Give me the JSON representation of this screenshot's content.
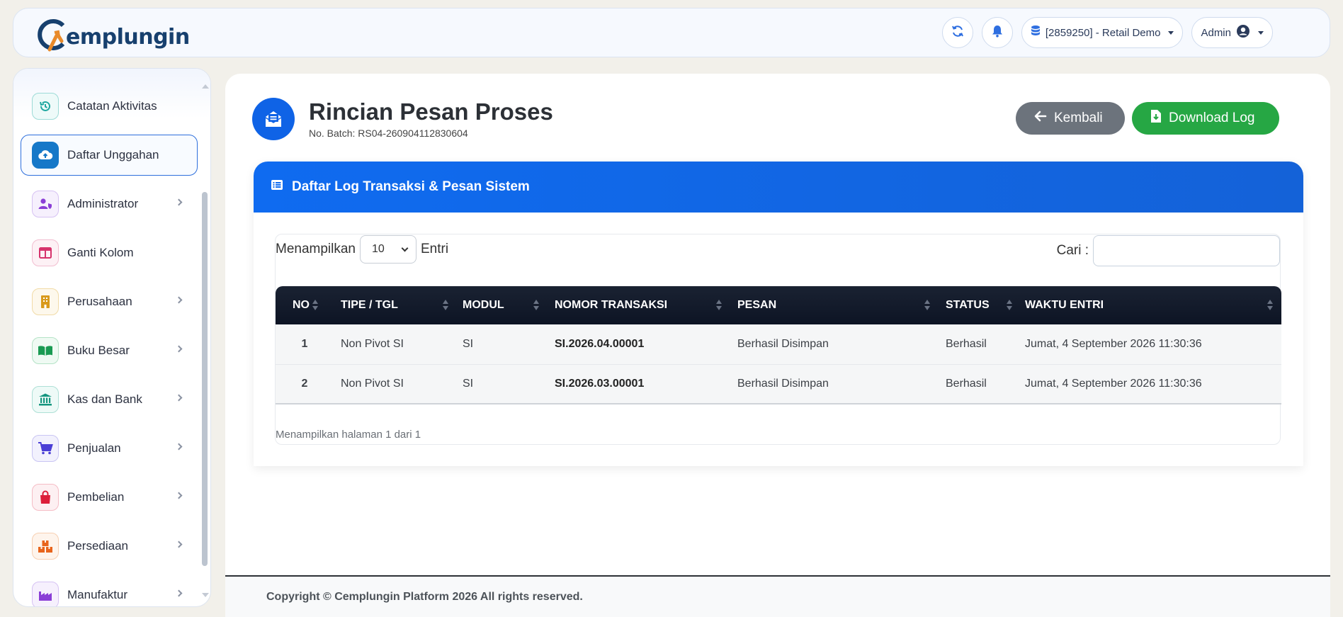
{
  "brand": {
    "name": "emplungin"
  },
  "header": {
    "database_label": "[2859250] - Retail Demo",
    "user_label": "Admin"
  },
  "sidebar": {
    "items": [
      {
        "label": "Catatan Aktivitas",
        "icon": "history-icon",
        "color": "#1fa7a0"
      },
      {
        "label": "Daftar Unggahan",
        "icon": "cloud-upload-icon",
        "color": "#1678c8",
        "active": true
      },
      {
        "label": "Administrator",
        "icon": "user-shield-icon",
        "color": "#8a3ed6"
      },
      {
        "label": "Ganti Kolom",
        "icon": "columns-icon",
        "color": "#d6336c"
      },
      {
        "label": "Perusahaan",
        "icon": "building-icon",
        "color": "#d99a1c"
      },
      {
        "label": "Buku Besar",
        "icon": "book-icon",
        "color": "#199a52"
      },
      {
        "label": "Kas dan Bank",
        "icon": "bank-icon",
        "color": "#15967f"
      },
      {
        "label": "Penjualan",
        "icon": "cart-icon",
        "color": "#4b3fd6"
      },
      {
        "label": "Pembelian",
        "icon": "bag-icon",
        "color": "#dc1f3a"
      },
      {
        "label": "Persediaan",
        "icon": "boxes-icon",
        "color": "#e8641c"
      },
      {
        "label": "Manufaktur",
        "icon": "industry-icon",
        "color": "#8a3ed6"
      }
    ]
  },
  "page": {
    "title": "Rincian Pesan Proses",
    "batch": "No. Batch: RS04-260904112830604",
    "back_label": "Kembali",
    "download_label": "Download Log"
  },
  "panel": {
    "title": "Daftar Log Transaksi & Pesan Sistem",
    "show_prefix": "Menampilkan",
    "page_length": "10",
    "show_suffix": "Entri",
    "search_label": "Cari :",
    "columns": [
      "NO",
      "TIPE / TGL",
      "MODUL",
      "NOMOR TRANSAKSI",
      "PESAN",
      "STATUS",
      "WAKTU ENTRI"
    ],
    "rows": [
      [
        "1",
        "Non Pivot SI",
        "SI",
        "SI.2026.04.00001",
        "Berhasil Disimpan",
        "Berhasil",
        "Jumat, 4 September 2026 11:30:36"
      ],
      [
        "2",
        "Non Pivot SI",
        "SI",
        "SI.2026.03.00001",
        "Berhasil Disimpan",
        "Berhasil",
        "Jumat, 4 September 2026 11:30:36"
      ]
    ],
    "page_info": "Menampilkan halaman 1 dari 1"
  },
  "footer": {
    "text": "Copyright © Cemplungin Platform 2026 All rights reserved."
  },
  "colors": {
    "primary": "#0f63e6",
    "success": "#26a744",
    "secondary": "#6c737c",
    "table_head": "#111a2a"
  }
}
